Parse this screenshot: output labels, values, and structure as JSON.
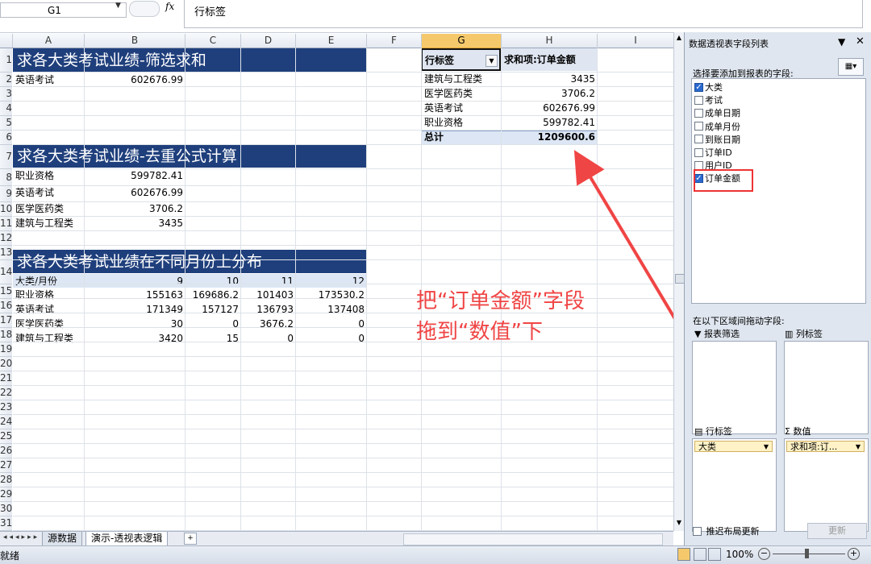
{
  "formula_bar": {
    "name_box": "G1",
    "fx": "fx",
    "content": "行标签"
  },
  "columns": [
    "A",
    "B",
    "C",
    "D",
    "E",
    "F",
    "G",
    "H",
    "I"
  ],
  "rows": [
    "1",
    "2",
    "3",
    "4",
    "5",
    "6",
    "7",
    "8",
    "9",
    "10",
    "11",
    "12",
    "13",
    "14",
    "15",
    "16",
    "17",
    "18",
    "19",
    "20",
    "21",
    "22",
    "23",
    "24",
    "25",
    "26",
    "27",
    "28",
    "29",
    "30",
    "31"
  ],
  "sec1": {
    "title": "求各大类考试业绩-筛选求和",
    "label": "英语考试",
    "value": "602676.99"
  },
  "sec2": {
    "title": "求各大类考试业绩-去重公式计算",
    "rows": [
      {
        "label": "职业资格",
        "value": "599782.41"
      },
      {
        "label": "英语考试",
        "value": "602676.99"
      },
      {
        "label": "医学医药类",
        "value": "3706.2"
      },
      {
        "label": "建筑与工程类",
        "value": "3435"
      }
    ]
  },
  "sec3": {
    "title": "求各大类考试业绩在不同月份上分布",
    "header": [
      "大类/月份",
      "9",
      "10",
      "11",
      "12"
    ],
    "rows": [
      [
        "职业资格",
        "155163",
        "169686.2",
        "101403",
        "173530.2"
      ],
      [
        "英语考试",
        "171349",
        "157127",
        "136793",
        "137408"
      ],
      [
        "医学医药类",
        "30",
        "0",
        "3676.2",
        "0"
      ],
      [
        "建筑与工程类",
        "3420",
        "15",
        "0",
        "0"
      ]
    ]
  },
  "pivot": {
    "row_label_header": "行标签",
    "value_header": "求和项:订单金额",
    "rows": [
      {
        "label": "建筑与工程类",
        "value": "3435"
      },
      {
        "label": "医学医药类",
        "value": "3706.2"
      },
      {
        "label": "英语考试",
        "value": "602676.99"
      },
      {
        "label": "职业资格",
        "value": "599782.41"
      }
    ],
    "total_label": "总计",
    "total_value": "1209600.6"
  },
  "annotation": {
    "line1": "把“订单金额”字段",
    "line2": "拖到“数值”下",
    "color": "#f04545"
  },
  "sheet_tabs": {
    "tab1": "源数据",
    "tab2": "演示-透视表逻辑"
  },
  "status": {
    "ready": "就绪",
    "zoom": "100%"
  },
  "field_list": {
    "title": "数据透视表字段列表",
    "choose_label": "选择要添加到报表的字段:",
    "fields": [
      {
        "name": "大类",
        "checked": true
      },
      {
        "name": "考试",
        "checked": false
      },
      {
        "name": "成单日期",
        "checked": false
      },
      {
        "name": "成单月份",
        "checked": false
      },
      {
        "name": "到账日期",
        "checked": false
      },
      {
        "name": "订单ID",
        "checked": false
      },
      {
        "name": "用户ID",
        "checked": false
      },
      {
        "name": "订单金额",
        "checked": true
      }
    ],
    "drag_label": "在以下区域间拖动字段:",
    "report_filter": "报表筛选",
    "column_labels": "列标签",
    "row_labels": "行标签",
    "values": "数值",
    "row_item": "大类",
    "value_item": "求和项:订...",
    "defer_label": "推迟布局更新",
    "update_button": "更新"
  }
}
